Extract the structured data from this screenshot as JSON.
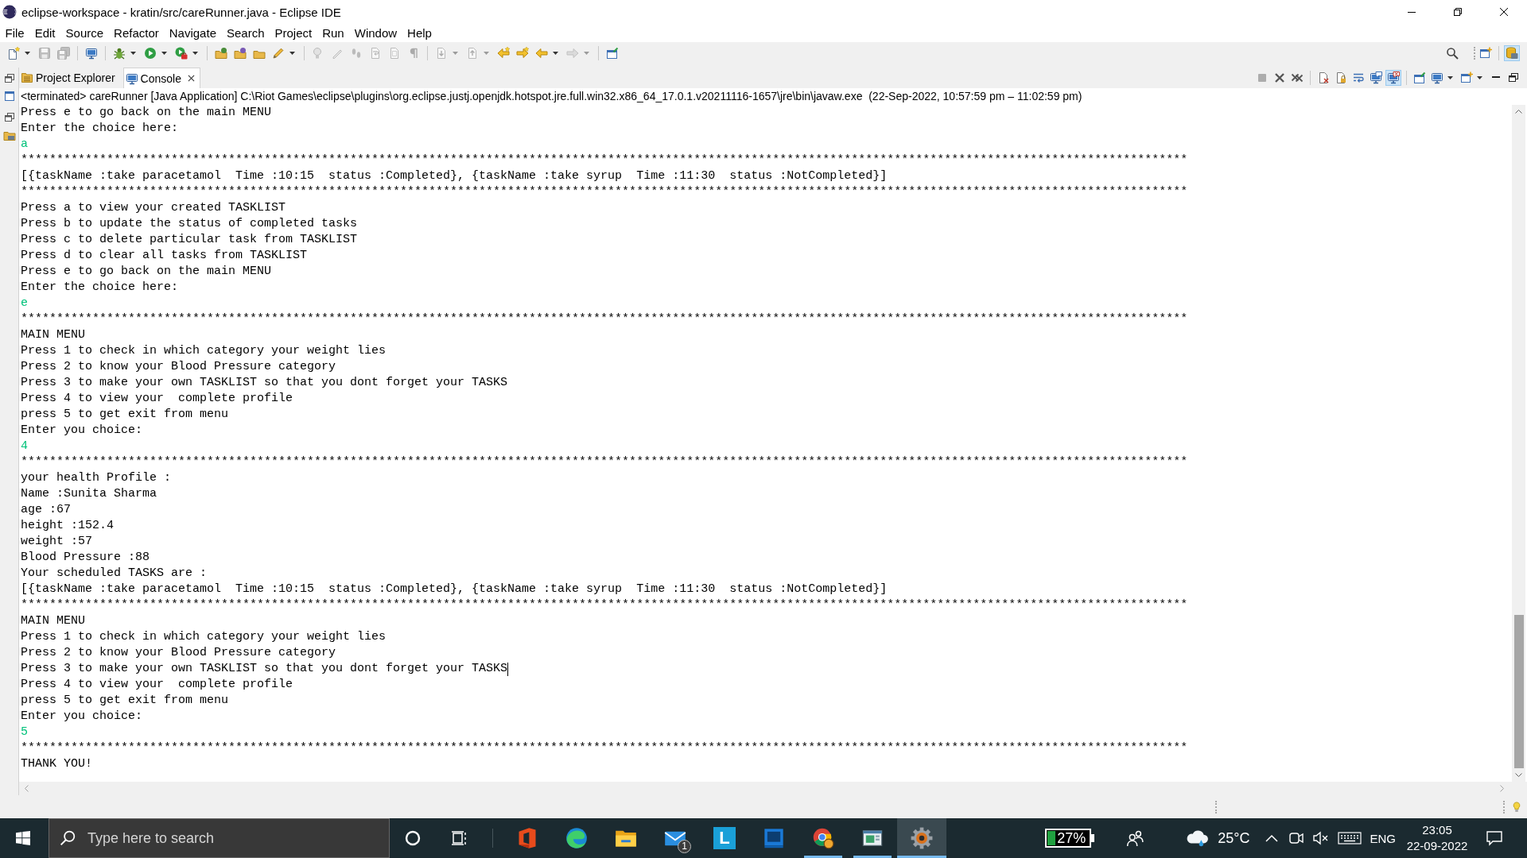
{
  "window": {
    "title": "eclipse-workspace - kratin/src/careRunner.java - Eclipse IDE"
  },
  "menu": [
    "File",
    "Edit",
    "Source",
    "Refactor",
    "Navigate",
    "Search",
    "Project",
    "Run",
    "Window",
    "Help"
  ],
  "toolbar": [
    [
      {
        "kind": "new",
        "disabled": false,
        "dropdown": true
      },
      {
        "kind": "save",
        "disabled": true,
        "dropdown": false
      },
      {
        "kind": "save-all",
        "disabled": true,
        "dropdown": false
      }
    ],
    [
      {
        "kind": "terminal",
        "disabled": false,
        "dropdown": false
      }
    ],
    [
      {
        "kind": "debug",
        "disabled": false,
        "dropdown": true
      },
      {
        "kind": "run",
        "disabled": false,
        "dropdown": true
      },
      {
        "kind": "external",
        "disabled": false,
        "dropdown": true
      }
    ],
    [
      {
        "kind": "open-type",
        "disabled": false,
        "dropdown": false
      },
      {
        "kind": "open-task",
        "disabled": false,
        "dropdown": false
      },
      {
        "kind": "open-folder",
        "disabled": false,
        "dropdown": false
      },
      {
        "kind": "brush",
        "disabled": false,
        "dropdown": true
      }
    ],
    [
      {
        "kind": "mark",
        "disabled": true,
        "dropdown": false
      },
      {
        "kind": "pen",
        "disabled": true,
        "dropdown": false
      },
      {
        "kind": "prints",
        "disabled": true,
        "dropdown": false
      },
      {
        "kind": "wrap",
        "disabled": true,
        "dropdown": false
      },
      {
        "kind": "block",
        "disabled": true,
        "dropdown": false
      },
      {
        "kind": "whitespace",
        "disabled": true,
        "dropdown": false
      }
    ],
    [
      {
        "kind": "next-ann",
        "disabled": true,
        "dropdown": true
      },
      {
        "kind": "prev-ann",
        "disabled": true,
        "dropdown": true
      },
      {
        "kind": "back-edit",
        "disabled": false,
        "dropdown": false
      },
      {
        "kind": "fwd-edit",
        "disabled": false,
        "dropdown": false
      },
      {
        "kind": "back",
        "disabled": false,
        "dropdown": true
      },
      {
        "kind": "forward",
        "disabled": true,
        "dropdown": true
      }
    ],
    [
      {
        "kind": "new-window",
        "disabled": false,
        "dropdown": false
      }
    ]
  ],
  "perspectives": [
    {
      "kind": "open-perspective",
      "selected": false
    },
    {
      "kind": "git",
      "selected": true
    }
  ],
  "tabs": [
    {
      "label": "Project Explorer",
      "kind": "explorer",
      "selected": false
    },
    {
      "label": "Console",
      "kind": "console",
      "selected": true
    }
  ],
  "console": {
    "tools": [
      [
        {
          "kind": "terminate",
          "disabled": true,
          "selected": false,
          "dropdown": false
        },
        {
          "kind": "remove",
          "disabled": false,
          "selected": false,
          "dropdown": false
        },
        {
          "kind": "remove-all",
          "disabled": false,
          "selected": false,
          "dropdown": false
        }
      ],
      [
        {
          "kind": "clear",
          "disabled": false,
          "selected": false,
          "dropdown": false
        },
        {
          "kind": "scroll-lock",
          "disabled": false,
          "selected": false,
          "dropdown": false
        },
        {
          "kind": "word-wrap",
          "disabled": false,
          "selected": false,
          "dropdown": false
        },
        {
          "kind": "show-out",
          "disabled": false,
          "selected": false,
          "dropdown": false
        },
        {
          "kind": "show-err",
          "disabled": false,
          "selected": true,
          "dropdown": false
        }
      ],
      [
        {
          "kind": "pin",
          "disabled": false,
          "selected": false,
          "dropdown": false
        },
        {
          "kind": "display",
          "disabled": false,
          "selected": false,
          "dropdown": true
        },
        {
          "kind": "open-console",
          "disabled": false,
          "selected": false,
          "dropdown": true
        }
      ]
    ],
    "process": "<terminated> careRunner [Java Application] C:\\Riot Games\\eclipse\\plugins\\org.eclipse.justj.openjdk.hotspot.jre.full.win32.x86_64_17.0.1.v20211116-1657\\jre\\bin\\javaw.exe  (22-Sep-2022, 10:57:59 pm – 11:02:59 pm)",
    "lines": [
      {
        "text": "Press e to go back on the main MENU",
        "kind": "output",
        "caret": false
      },
      {
        "text": "Enter the choice here:",
        "kind": "output",
        "caret": false
      },
      {
        "text": "a",
        "kind": "input",
        "caret": false
      },
      {
        "text": "*******************************************************************************************************************************************************************",
        "kind": "output",
        "caret": false
      },
      {
        "text": "[{taskName :take paracetamol  Time :10:15  status :Completed}, {taskName :take syrup  Time :11:30  status :NotCompleted}]",
        "kind": "output",
        "caret": false
      },
      {
        "text": "*******************************************************************************************************************************************************************",
        "kind": "output",
        "caret": false
      },
      {
        "text": "Press a to view your created TASKLIST",
        "kind": "output",
        "caret": false
      },
      {
        "text": "Press b to update the status of completed tasks",
        "kind": "output",
        "caret": false
      },
      {
        "text": "Press c to delete particular task from TASKLIST",
        "kind": "output",
        "caret": false
      },
      {
        "text": "Press d to clear all tasks from TASKLIST",
        "kind": "output",
        "caret": false
      },
      {
        "text": "Press e to go back on the main MENU",
        "kind": "output",
        "caret": false
      },
      {
        "text": "Enter the choice here:",
        "kind": "output",
        "caret": false
      },
      {
        "text": "e",
        "kind": "input",
        "caret": false
      },
      {
        "text": "*******************************************************************************************************************************************************************",
        "kind": "output",
        "caret": false
      },
      {
        "text": "MAIN MENU",
        "kind": "output",
        "caret": false
      },
      {
        "text": "Press 1 to check in which category your weight lies",
        "kind": "output",
        "caret": false
      },
      {
        "text": "Press 2 to know your Blood Pressure category",
        "kind": "output",
        "caret": false
      },
      {
        "text": "Press 3 to make your own TASKLIST so that you dont forget your TASKS",
        "kind": "output",
        "caret": false
      },
      {
        "text": "Press 4 to view your  complete profile",
        "kind": "output",
        "caret": false
      },
      {
        "text": "press 5 to get exit from menu",
        "kind": "output",
        "caret": false
      },
      {
        "text": "Enter you choice:",
        "kind": "output",
        "caret": false
      },
      {
        "text": "4",
        "kind": "input",
        "caret": false
      },
      {
        "text": "*******************************************************************************************************************************************************************",
        "kind": "output",
        "caret": false
      },
      {
        "text": "your health Profile :",
        "kind": "output",
        "caret": false
      },
      {
        "text": "Name :Sunita Sharma",
        "kind": "output",
        "caret": false
      },
      {
        "text": "age :67",
        "kind": "output",
        "caret": false
      },
      {
        "text": "height :152.4",
        "kind": "output",
        "caret": false
      },
      {
        "text": "weight :57",
        "kind": "output",
        "caret": false
      },
      {
        "text": "Blood Pressure :88",
        "kind": "output",
        "caret": false
      },
      {
        "text": "Your scheduled TASKS are :",
        "kind": "output",
        "caret": false
      },
      {
        "text": "[{taskName :take paracetamol  Time :10:15  status :Completed}, {taskName :take syrup  Time :11:30  status :NotCompleted}]",
        "kind": "output",
        "caret": false
      },
      {
        "text": "*******************************************************************************************************************************************************************",
        "kind": "output",
        "caret": false
      },
      {
        "text": "MAIN MENU",
        "kind": "output",
        "caret": false
      },
      {
        "text": "Press 1 to check in which category your weight lies",
        "kind": "output",
        "caret": false
      },
      {
        "text": "Press 2 to know your Blood Pressure category",
        "kind": "output",
        "caret": false
      },
      {
        "text": "Press 3 to make your own TASKLIST so that you dont forget your TASKS",
        "kind": "output",
        "caret": true
      },
      {
        "text": "Press 4 to view your  complete profile",
        "kind": "output",
        "caret": false
      },
      {
        "text": "press 5 to get exit from menu",
        "kind": "output",
        "caret": false
      },
      {
        "text": "Enter you choice:",
        "kind": "output",
        "caret": false
      },
      {
        "text": "5",
        "kind": "input",
        "caret": false
      },
      {
        "text": "*******************************************************************************************************************************************************************",
        "kind": "output",
        "caret": false
      },
      {
        "text": "THANK YOU!",
        "kind": "output",
        "caret": false
      }
    ]
  },
  "taskbar": {
    "search": {
      "placeholder": "Type here to search"
    },
    "apps": [
      {
        "kind": "bracket",
        "running": false,
        "selected": false
      },
      {
        "kind": "swirl",
        "running": false,
        "selected": false
      },
      {
        "kind": "folder",
        "running": false,
        "selected": false
      },
      {
        "kind": "envelope",
        "running": false,
        "selected": false,
        "badge": "1"
      },
      {
        "kind": "letter",
        "running": false,
        "selected": false,
        "label": "L"
      },
      {
        "kind": "tablet",
        "running": false,
        "selected": false
      },
      {
        "kind": "wheel",
        "running": true,
        "selected": false
      },
      {
        "kind": "window",
        "running": true,
        "selected": false
      },
      {
        "kind": "gear",
        "running": true,
        "selected": true
      }
    ],
    "battery": "27%",
    "weather": "25°C",
    "language": "ENG",
    "time": "23:05",
    "date": "22-09-2022"
  }
}
